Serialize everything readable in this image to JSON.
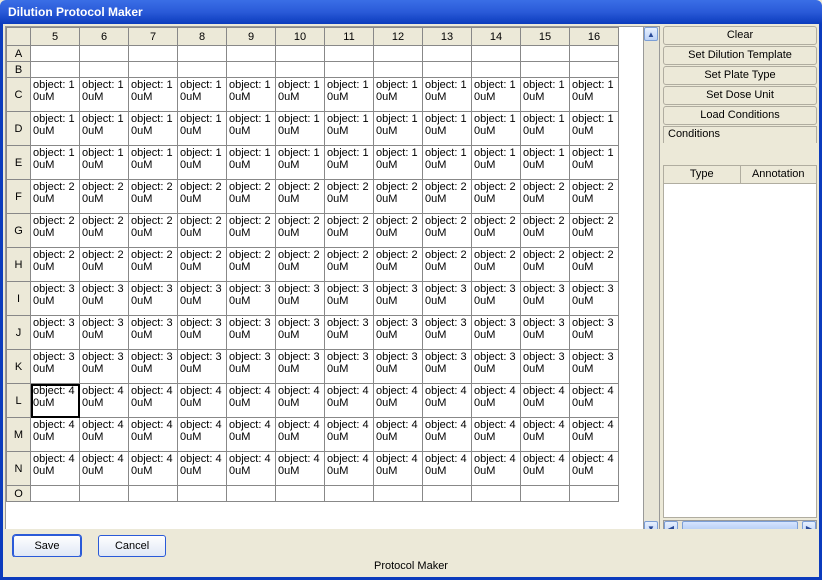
{
  "window": {
    "title": "Dilution Protocol Maker"
  },
  "status_text": "Protocol Maker",
  "buttons": {
    "save": "Save",
    "cancel": "Cancel"
  },
  "actions": {
    "clear": "Clear",
    "set_dilution_template": "Set Dilution Template",
    "set_plate_type": "Set Plate Type",
    "set_dose_unit": "Set Dose Unit",
    "load_conditions": "Load Conditions"
  },
  "conditions": {
    "header": "Conditions",
    "col_type": "Type",
    "col_annotation": "Annotation"
  },
  "grid": {
    "columns": [
      "5",
      "6",
      "7",
      "8",
      "9",
      "10",
      "11",
      "12",
      "13",
      "14",
      "15",
      "16"
    ],
    "row_headers": [
      "A",
      "B",
      "C",
      "D",
      "E",
      "F",
      "G",
      "H",
      "I",
      "J",
      "K",
      "L",
      "M",
      "N",
      "O"
    ],
    "selected": {
      "row": "L",
      "col": "5"
    },
    "rows": {
      "A": [
        "",
        "",
        "",
        "",
        "",
        "",
        "",
        "",
        "",
        "",
        "",
        ""
      ],
      "B": [
        "",
        "",
        "",
        "",
        "",
        "",
        "",
        "",
        "",
        "",
        "",
        ""
      ],
      "C": [
        "object: 1 0uM",
        "object: 1 0uM",
        "object: 1 0uM",
        "object: 1 0uM",
        "object: 1 0uM",
        "object: 1 0uM",
        "object: 1 0uM",
        "object: 1 0uM",
        "object: 1 0uM",
        "object: 1 0uM",
        "object: 1 0uM",
        "object: 1 0uM"
      ],
      "D": [
        "object: 1 0uM",
        "object: 1 0uM",
        "object: 1 0uM",
        "object: 1 0uM",
        "object: 1 0uM",
        "object: 1 0uM",
        "object: 1 0uM",
        "object: 1 0uM",
        "object: 1 0uM",
        "object: 1 0uM",
        "object: 1 0uM",
        "object: 1 0uM"
      ],
      "E": [
        "object: 1 0uM",
        "object: 1 0uM",
        "object: 1 0uM",
        "object: 1 0uM",
        "object: 1 0uM",
        "object: 1 0uM",
        "object: 1 0uM",
        "object: 1 0uM",
        "object: 1 0uM",
        "object: 1 0uM",
        "object: 1 0uM",
        "object: 1 0uM"
      ],
      "F": [
        "object: 2 0uM",
        "object: 2 0uM",
        "object: 2 0uM",
        "object: 2 0uM",
        "object: 2 0uM",
        "object: 2 0uM",
        "object: 2 0uM",
        "object: 2 0uM",
        "object: 2 0uM",
        "object: 2 0uM",
        "object: 2 0uM",
        "object: 2 0uM"
      ],
      "G": [
        "object: 2 0uM",
        "object: 2 0uM",
        "object: 2 0uM",
        "object: 2 0uM",
        "object: 2 0uM",
        "object: 2 0uM",
        "object: 2 0uM",
        "object: 2 0uM",
        "object: 2 0uM",
        "object: 2 0uM",
        "object: 2 0uM",
        "object: 2 0uM"
      ],
      "H": [
        "object: 2 0uM",
        "object: 2 0uM",
        "object: 2 0uM",
        "object: 2 0uM",
        "object: 2 0uM",
        "object: 2 0uM",
        "object: 2 0uM",
        "object: 2 0uM",
        "object: 2 0uM",
        "object: 2 0uM",
        "object: 2 0uM",
        "object: 2 0uM"
      ],
      "I": [
        "object: 3 0uM",
        "object: 3 0uM",
        "object: 3 0uM",
        "object: 3 0uM",
        "object: 3 0uM",
        "object: 3 0uM",
        "object: 3 0uM",
        "object: 3 0uM",
        "object: 3 0uM",
        "object: 3 0uM",
        "object: 3 0uM",
        "object: 3 0uM"
      ],
      "J": [
        "object: 3 0uM",
        "object: 3 0uM",
        "object: 3 0uM",
        "object: 3 0uM",
        "object: 3 0uM",
        "object: 3 0uM",
        "object: 3 0uM",
        "object: 3 0uM",
        "object: 3 0uM",
        "object: 3 0uM",
        "object: 3 0uM",
        "object: 3 0uM"
      ],
      "K": [
        "object: 3 0uM",
        "object: 3 0uM",
        "object: 3 0uM",
        "object: 3 0uM",
        "object: 3 0uM",
        "object: 3 0uM",
        "object: 3 0uM",
        "object: 3 0uM",
        "object: 3 0uM",
        "object: 3 0uM",
        "object: 3 0uM",
        "object: 3 0uM"
      ],
      "L": [
        "object: 4 0uM",
        "object: 4 0uM",
        "object: 4 0uM",
        "object: 4 0uM",
        "object: 4 0uM",
        "object: 4 0uM",
        "object: 4 0uM",
        "object: 4 0uM",
        "object: 4 0uM",
        "object: 4 0uM",
        "object: 4 0uM",
        "object: 4 0uM"
      ],
      "M": [
        "object: 4 0uM",
        "object: 4 0uM",
        "object: 4 0uM",
        "object: 4 0uM",
        "object: 4 0uM",
        "object: 4 0uM",
        "object: 4 0uM",
        "object: 4 0uM",
        "object: 4 0uM",
        "object: 4 0uM",
        "object: 4 0uM",
        "object: 4 0uM"
      ],
      "N": [
        "object: 4 0uM",
        "object: 4 0uM",
        "object: 4 0uM",
        "object: 4 0uM",
        "object: 4 0uM",
        "object: 4 0uM",
        "object: 4 0uM",
        "object: 4 0uM",
        "object: 4 0uM",
        "object: 4 0uM",
        "object: 4 0uM",
        "object: 4 0uM"
      ],
      "O": [
        "",
        "",
        "",
        "",
        "",
        "",
        "",
        "",
        "",
        "",
        "",
        ""
      ]
    }
  }
}
